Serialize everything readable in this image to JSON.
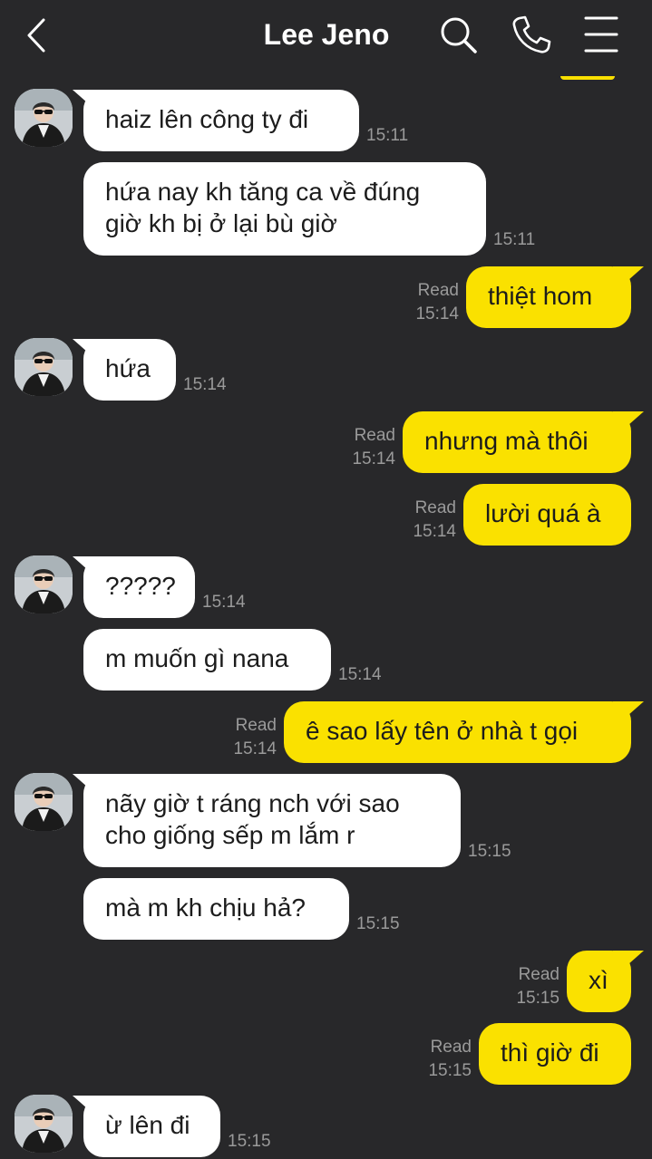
{
  "header": {
    "title": "Lee Jeno",
    "back_icon": "chevron-left-icon",
    "search_icon": "search-icon",
    "call_icon": "phone-icon",
    "menu_icon": "menu-icon"
  },
  "colors": {
    "background": "#28282a",
    "incoming_bubble": "#ffffff",
    "outgoing_bubble": "#fae100",
    "meta_text": "#9a9a9a"
  },
  "messages": [
    {
      "dir": "in",
      "avatar": true,
      "text": "haiz lên công ty đi",
      "time": "15:11"
    },
    {
      "dir": "in",
      "avatar": false,
      "lines": [
        "hứa nay kh tăng ca về đúng",
        "giờ kh bị ở lại bù giờ"
      ],
      "time": "15:11"
    },
    {
      "dir": "out",
      "text": "thiệt hom",
      "read": "Read",
      "time": "15:14"
    },
    {
      "dir": "in",
      "avatar": true,
      "text": "hứa",
      "time": "15:14"
    },
    {
      "dir": "out",
      "text": "nhưng mà thôi",
      "read": "Read",
      "time": "15:14"
    },
    {
      "dir": "out",
      "text": "lười quá à",
      "read": "Read",
      "time": "15:14"
    },
    {
      "dir": "in",
      "avatar": true,
      "text": "?????",
      "time": "15:14"
    },
    {
      "dir": "in",
      "avatar": false,
      "text": "m muốn gì nana",
      "time": "15:14"
    },
    {
      "dir": "out",
      "text": "ê sao lấy tên ở nhà t gọi",
      "read": "Read",
      "time": "15:14"
    },
    {
      "dir": "in",
      "avatar": true,
      "lines": [
        "nãy giờ t ráng nch với sao",
        "cho giống sếp m lắm r"
      ],
      "time": "15:15"
    },
    {
      "dir": "in",
      "avatar": false,
      "text": "mà m kh chịu hả?",
      "time": "15:15"
    },
    {
      "dir": "out",
      "text": "xì",
      "read": "Read",
      "time": "15:15"
    },
    {
      "dir": "out",
      "text": "thì giờ đi",
      "read": "Read",
      "time": "15:15"
    },
    {
      "dir": "in",
      "avatar": true,
      "text": "ừ lên đi",
      "time": "15:15"
    }
  ]
}
